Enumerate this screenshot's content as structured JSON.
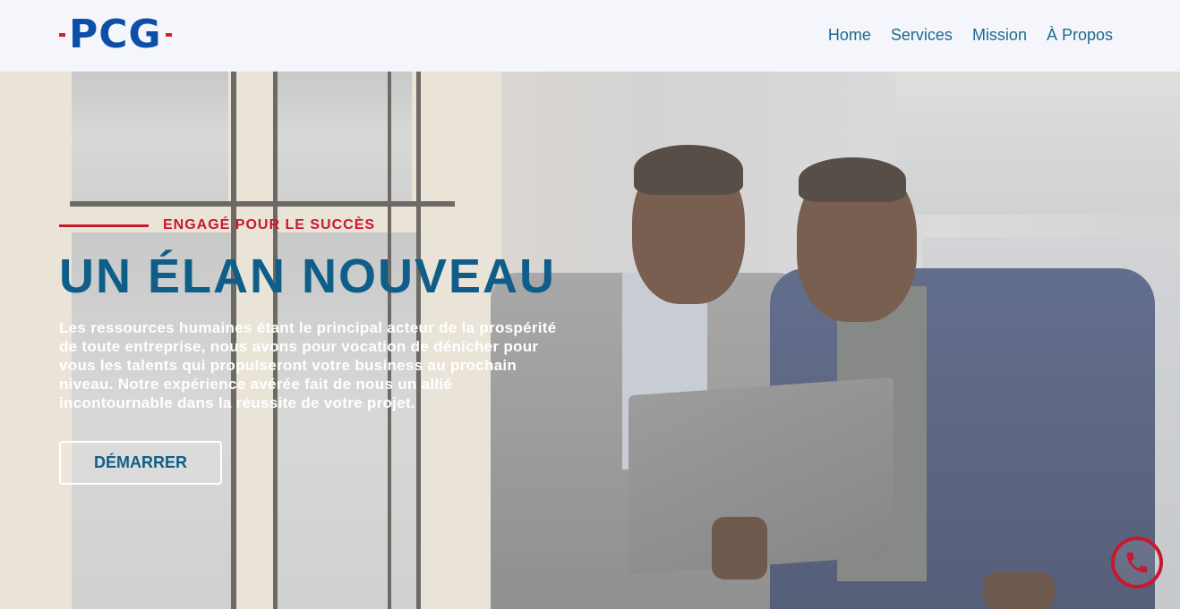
{
  "header": {
    "logo_text": "PCG",
    "nav": [
      "Home",
      "Services",
      "Mission",
      "À Propos"
    ]
  },
  "hero": {
    "tagline": "ENGAGÉ POUR LE SUCCÈS",
    "title": "UN ÉLAN NOUVEAU",
    "description": "Les ressources humaines étant le principal acteur de la prospérité de toute entreprise, nous avons pour vocation de dénicher pour vous les talents qui propulseront votre business au prochain niveau. Notre expérience avérée fait de nous un allié incontournable dans la réussite de votre projet.",
    "cta_label": "DÉMARRER"
  },
  "colors": {
    "brand_blue": "#0f5e8a",
    "accent_red": "#c8182d",
    "header_bg": "#f4f6fc"
  },
  "icons": {
    "floating": "whatsapp-icon"
  }
}
